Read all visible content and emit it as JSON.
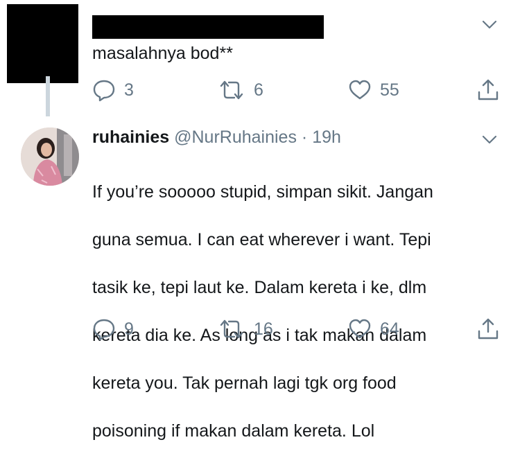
{
  "reply": {
    "text": "masalahnya bod**",
    "actions": {
      "replies": "3",
      "retweets": "6",
      "likes": "55"
    }
  },
  "tweet": {
    "name": "ruhainies",
    "handle": "@NurRuhainies",
    "separator": "·",
    "time": "19h",
    "lines": [
      "If you’re sooooo stupid, simpan sikit. Jangan",
      "guna semua. I can eat wherever i want. Tepi",
      "tasik ke, tepi laut ke. Dalam kereta i ke, dlm",
      "kereta dia ke. As long as i tak makan dalam",
      "kereta you. Tak pernah lagi tgk org food",
      "poisoning if makan dalam kereta. Lol"
    ],
    "actions": {
      "replies": "9",
      "retweets": "16",
      "likes": "64"
    }
  },
  "icons": [
    "reply-icon",
    "retweet-icon",
    "like-icon",
    "share-icon",
    "chevron-down-icon"
  ],
  "colors": {
    "muted": "#657786",
    "text": "#14171a",
    "thread": "#ccd6dd"
  }
}
